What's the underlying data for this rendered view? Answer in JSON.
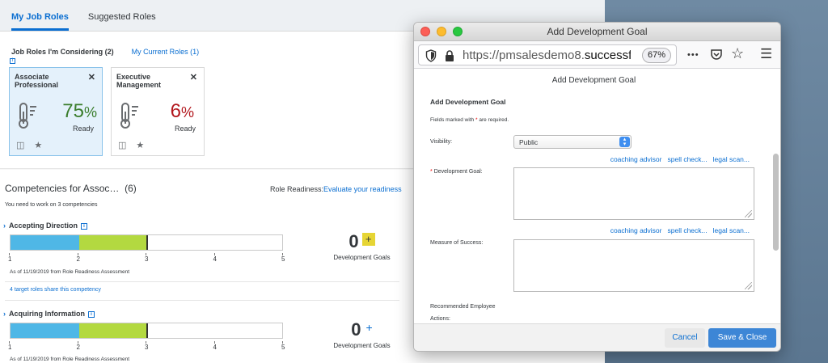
{
  "nav": {
    "tabs": [
      {
        "label": "My Job Roles",
        "active": true
      },
      {
        "label": "Suggested Roles",
        "active": false
      }
    ]
  },
  "roles": {
    "considering_label": "Job Roles I'm Considering (2)",
    "current_label": "My Current Roles (1)",
    "info_glyph": "i",
    "cards": [
      {
        "name": "Associate Professional",
        "percent": "75",
        "percent_sign": "%",
        "status": "Ready",
        "color": "#3a7d2c",
        "selected": true,
        "close_glyph": "✕"
      },
      {
        "name": "Executive Management",
        "percent": "6",
        "percent_sign": "%",
        "status": "Ready",
        "color": "#b2171d",
        "selected": false,
        "close_glyph": "✕"
      }
    ]
  },
  "competencies": {
    "header_title": "Competencies for Assoc…",
    "header_count": "(6)",
    "readiness_label": "Role Readiness:",
    "readiness_link": "Evaluate your readiness",
    "need_text": "You need to work on 3 competencies",
    "scale_ticks": [
      "1",
      "2",
      "3",
      "4",
      "5"
    ],
    "items": [
      {
        "title": "Accepting Direction",
        "chevron": "›",
        "info_glyph": "i",
        "current_level": 2,
        "target_level": 3,
        "as_of": "As of 11/19/2019 from Role Readiness Assessment",
        "goals_count": "0",
        "goals_plus": "+",
        "goals_label": "Development Goals",
        "share_link": "4 target roles share this competency"
      },
      {
        "title": "Acquiring Information",
        "chevron": "›",
        "info_glyph": "i",
        "current_level": 2,
        "target_level": 3,
        "as_of": "As of 11/19/2019 from Role Readiness Assessment",
        "goals_count": "0",
        "goals_plus": "+",
        "goals_label": "Development Goals"
      }
    ]
  },
  "browser": {
    "window_title": "Add Development Goal",
    "url_prefix": "https://pmsalesdemo8.",
    "url_host": "successfac",
    "zoom": "67%",
    "icons": [
      "shield-icon",
      "lock-icon",
      "more-icon",
      "pocket-icon",
      "star-icon",
      "menu-icon"
    ],
    "more_glyph": "•••",
    "menu_glyph": "☰",
    "star_glyph": "☆"
  },
  "dialog": {
    "header": "Add Development Goal",
    "subtitle": "Add Development Goal",
    "required_note_pre": "Fields marked with ",
    "required_note_ast": "*",
    "required_note_post": " are required.",
    "visibility_label": "Visibility:",
    "visibility_value": "Public",
    "goal_label": "Development Goal:",
    "goal_asterisk": "*",
    "goal_value": "",
    "links": [
      "coaching advisor",
      "spell check...",
      "legal scan..."
    ],
    "measure_label": "Measure of Success:",
    "measure_value": "",
    "recommended_label_1": "Recommended Employee",
    "recommended_label_2": "Actions:",
    "cancel_label": "Cancel",
    "save_label": "Save & Close"
  }
}
